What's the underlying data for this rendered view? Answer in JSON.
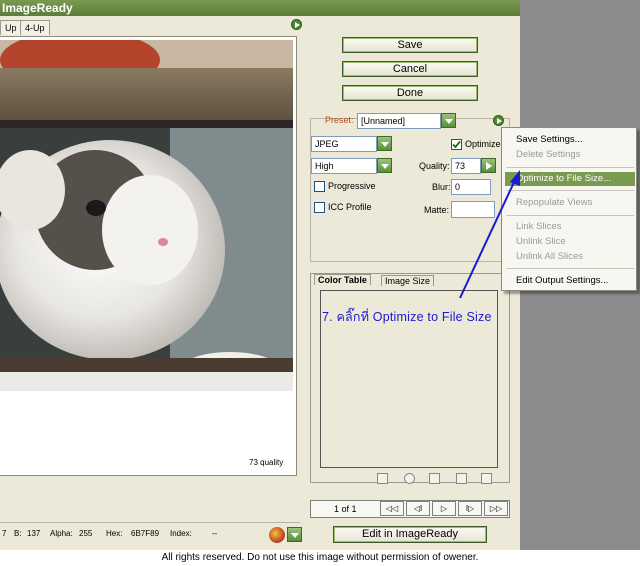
{
  "window": {
    "title": "ImageReady"
  },
  "tabs": [
    "Up",
    "4-Up"
  ],
  "buttons": {
    "save": "Save",
    "cancel": "Cancel",
    "done": "Done",
    "edit_in_imageready": "Edit in ImageReady"
  },
  "settings": {
    "preset_label": "Preset:",
    "preset_value": "[Unnamed]",
    "format_value": "JPEG",
    "quality_level_value": "High",
    "optimized_label": "Optimized",
    "optimized_checked": true,
    "quality_label": "Quality:",
    "quality_value": "73",
    "blur_label": "Blur:",
    "blur_value": "0",
    "matte_label": "Matte:",
    "progressive_label": "Progressive",
    "icc_label": "ICC Profile"
  },
  "menu": {
    "items": [
      {
        "label": "Save Settings...",
        "enabled": true
      },
      {
        "label": "Delete Settings",
        "enabled": false
      },
      {
        "label": "Optimize to File Size...",
        "enabled": true,
        "highlighted": true
      },
      {
        "label": "Repopulate Views",
        "enabled": false
      },
      {
        "label": "Link Slices",
        "enabled": false
      },
      {
        "label": "Unlink Slice",
        "enabled": false
      },
      {
        "label": "Unlink All Slices",
        "enabled": false
      },
      {
        "label": "Edit Output Settings...",
        "enabled": true
      }
    ]
  },
  "panel_tabs": {
    "color_table": "Color Table",
    "image_size": "Image Size"
  },
  "canvas": {
    "quality_caption": "73 quality"
  },
  "pager": {
    "text": "1 of 1",
    "buttons": [
      "◁◁",
      "◁I",
      "▷",
      "I▷",
      "▷▷"
    ]
  },
  "status": {
    "g_partial": "7",
    "b_label": "B:",
    "b_value": "137",
    "alpha_label": "Alpha:",
    "alpha_value": "255",
    "hex_label": "Hex:",
    "hex_value": "6B7F89",
    "index_label": "Index:",
    "index_value": "--"
  },
  "annotation": "7. คลิ๊กที่ Optimize to File Size",
  "footer": "All rights reserved. Do not use this image without permission of owener.",
  "colors": {
    "accent_green": "#5c7d3a",
    "highlight": "#7a9a52",
    "annotation_blue": "#1a1ad0",
    "dialog_bg": "#ece9d8"
  }
}
